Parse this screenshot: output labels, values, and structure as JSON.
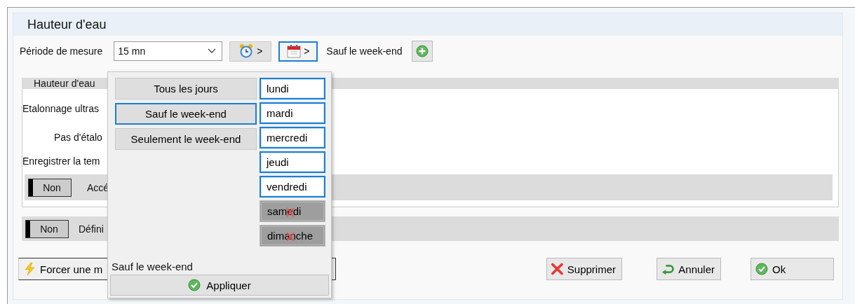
{
  "window": {
    "title": "Hauteur d'eau"
  },
  "period": {
    "label": "Période de mesure",
    "value": "15 mn"
  },
  "toolbar_buttons": [
    {
      "kind": "clock",
      "label": ">",
      "selected": false
    },
    {
      "kind": "calendar",
      "label": ">",
      "selected": true
    }
  ],
  "schedule_summary": "Sauf le week-end",
  "tab": {
    "label": "Hauteur d'eau"
  },
  "fields": [
    {
      "kind": "line",
      "label": "Etalonnage ultras"
    },
    {
      "kind": "indented",
      "label": "Pas d'étalo"
    },
    {
      "kind": "line",
      "label": "Enregistrer la tem"
    }
  ],
  "toggles": [
    {
      "state": "Non",
      "on": false,
      "label": "Accé"
    },
    {
      "state": "Non",
      "on": false,
      "label": "Défini"
    }
  ],
  "force_button": {
    "label": "Forcer une m"
  },
  "actions": [
    {
      "kind": "delete",
      "label": "Supprimer"
    },
    {
      "kind": "cancel",
      "label": "Annuler"
    },
    {
      "kind": "ok",
      "label": "Ok"
    }
  ],
  "popup": {
    "modes": [
      {
        "label": "Tous les jours",
        "selected": false
      },
      {
        "label": "Sauf le week-end",
        "selected": true
      },
      {
        "label": "Seulement le week-end",
        "selected": false
      }
    ],
    "days": [
      {
        "label": "lundi",
        "selected": true
      },
      {
        "label": "mardi",
        "selected": true
      },
      {
        "label": "mercredi",
        "selected": true
      },
      {
        "label": "jeudi",
        "selected": true
      },
      {
        "label": "vendredi",
        "selected": true
      },
      {
        "label": "samedi",
        "selected": false
      },
      {
        "label": "dimanche",
        "selected": false
      }
    ],
    "summary": "Sauf le week-end",
    "apply": "Appliquer"
  }
}
